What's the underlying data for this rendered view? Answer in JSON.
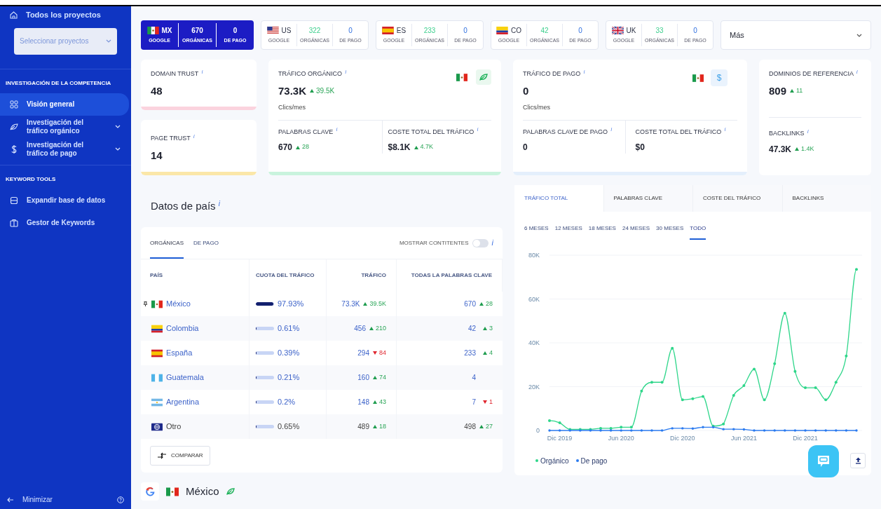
{
  "sidebar": {
    "top_link": "Todos los proyectos",
    "project_select": {
      "placeholder": "Seleccionar proyectos"
    },
    "sections": [
      {
        "heading": "INVESTIGACIÓN DE LA COMPETENCIA",
        "items": [
          {
            "label": "Visión general",
            "kind": "link",
            "selected": true
          },
          {
            "label": "Investigación del tráfico orgánico",
            "kind": "group",
            "selected": false
          },
          {
            "label": "Investigación del tráfico de pago",
            "kind": "group",
            "selected": false
          }
        ]
      },
      {
        "heading": "KEYWORD TOOLS",
        "items": [
          {
            "label": "Expandir base de datos",
            "kind": "link",
            "selected": false
          },
          {
            "label": "Gestor de Keywords",
            "kind": "link",
            "selected": false
          }
        ]
      }
    ],
    "minimize": "Minimizar"
  },
  "markets": [
    {
      "code": "MX",
      "engine": "GOOGLE",
      "organic": "670",
      "organic_label": "ORGÁNICAS",
      "paid": "0",
      "paid_label": "DE PAGO",
      "selected": true
    },
    {
      "code": "US",
      "engine": "GOOGLE",
      "organic": "322",
      "organic_label": "ORGÁNICAS",
      "paid": "0",
      "paid_label": "DE PAGO",
      "selected": false
    },
    {
      "code": "ES",
      "engine": "GOOGLE",
      "organic": "233",
      "organic_label": "ORGÁNICAS",
      "paid": "0",
      "paid_label": "DE PAGO",
      "selected": false
    },
    {
      "code": "CO",
      "engine": "GOOGLE",
      "organic": "42",
      "organic_label": "ORGÁNICAS",
      "paid": "0",
      "paid_label": "DE PAGO",
      "selected": false
    },
    {
      "code": "UK",
      "engine": "GOOGLE",
      "organic": "33",
      "organic_label": "ORGÁNICAS",
      "paid": "0",
      "paid_label": "DE PAGO",
      "selected": false
    }
  ],
  "more_select": {
    "value": "Más"
  },
  "metrics": {
    "domain_trust": {
      "label": "DOMAIN TRUST $^{i}$",
      "value": "48"
    },
    "page_trust": {
      "label": "PAGE TRUST $^{i}$",
      "value": "14"
    },
    "organic": {
      "label": "TRÁFICO ORGÁNICO $^{i}$",
      "value": "73.3K",
      "delta": {
        "text": "39.5K",
        "rising": true
      },
      "unit": "Clics/mes",
      "keywords": {
        "label": "PALABRAS CLAVE $^{i}$",
        "value": "670",
        "delta": {
          "text": "28",
          "rising": true
        }
      },
      "cost": {
        "label": "COSTE TOTAL DEL TRÁFICO $^{i}$",
        "value": "$8.1K",
        "delta": {
          "text": "4.7K",
          "rising": true
        }
      }
    },
    "paid": {
      "label": "TRÁFICO DE PAGO $^{i}$",
      "value": "0",
      "unit": "Clics/mes",
      "currency": "$",
      "keywords": {
        "label": "PALABRAS CLAVE DE PAGO $^{i}$",
        "value": "0"
      },
      "cost": {
        "label": "COSTE TOTAL DEL TRÁFICO $^{i}$",
        "value": "$0"
      }
    },
    "referring": {
      "domains": {
        "label": "DOMINIOS DE REFERENCIA $^{i}$",
        "value": "809",
        "delta": {
          "text": "11",
          "rising": true
        }
      },
      "backlinks": {
        "label": "BACKLINKS $^{i}$",
        "value": "47.3K",
        "delta": {
          "text": "1.4K",
          "rising": true
        }
      }
    }
  },
  "country_data": {
    "title": "Datos de país $^{i}$",
    "tabs": [
      {
        "label": "ORGÁNICAS",
        "selected": true
      },
      {
        "label": "DE PAGO",
        "selected": false
      }
    ],
    "continents_toggle": {
      "label": "MOSTRAR CONTITENTES",
      "on": false,
      "info": "i"
    },
    "columns": [
      "PAÍS",
      "CUOTA DEL TRÁFICO",
      "TRÁFICO",
      "TODAS LA PALABRAS CLAVE"
    ],
    "rows": [
      {
        "kind": "country",
        "pinned": true,
        "name": "México",
        "level": 0.9793,
        "share": "97.93%",
        "traffic": "73.3K",
        "traffic_delta": {
          "text": "39.5K",
          "rising": true
        },
        "keywords": "670",
        "keywords_delta": {
          "text": "28",
          "rising": true
        }
      },
      {
        "kind": "country",
        "pinned": false,
        "name": "Colombia",
        "level": 0.0061,
        "share": "0.61%",
        "traffic": "456",
        "traffic_delta": {
          "text": "210",
          "rising": true
        },
        "keywords": "42",
        "keywords_delta": {
          "text": "3",
          "rising": true
        }
      },
      {
        "kind": "country",
        "pinned": false,
        "name": "España",
        "level": 0.0039,
        "share": "0.39%",
        "traffic": "294",
        "traffic_delta": {
          "text": "84",
          "rising": false
        },
        "keywords": "233",
        "keywords_delta": {
          "text": "4",
          "rising": true
        }
      },
      {
        "kind": "country",
        "pinned": false,
        "name": "Guatemala",
        "level": 0.0021,
        "share": "0.21%",
        "traffic": "160",
        "traffic_delta": {
          "text": "74",
          "rising": true
        },
        "keywords": "4"
      },
      {
        "kind": "country",
        "pinned": false,
        "name": "Argentina",
        "level": 0.002,
        "share": "0.2%",
        "traffic": "148",
        "traffic_delta": {
          "text": "43",
          "rising": true
        },
        "keywords": "7",
        "keywords_delta": {
          "text": "1",
          "rising": false
        }
      },
      {
        "kind": "other",
        "pinned": false,
        "name": "Otro",
        "level": 0.0065,
        "share": "0.65%",
        "traffic": "489",
        "traffic_delta": {
          "text": "18",
          "rising": true
        },
        "keywords": "498",
        "keywords_delta": {
          "text": "27",
          "rising": true
        }
      }
    ],
    "compare_button": "COMPARAR"
  },
  "traffic_chart": {
    "tabs": [
      {
        "label": "TRÁFICO TOTAL",
        "selected": true
      },
      {
        "label": "PALABRAS CLAVE",
        "selected": false
      },
      {
        "label": "COSTE DEL TRÁFICO",
        "selected": false
      },
      {
        "label": "BACKLINKS",
        "selected": false
      }
    ],
    "periods": [
      {
        "label": "6 MESES",
        "selected": false
      },
      {
        "label": "12 MESES",
        "selected": false
      },
      {
        "label": "18 MESES",
        "selected": false
      },
      {
        "label": "24 MESES",
        "selected": false
      },
      {
        "label": "30 MESES",
        "selected": false
      },
      {
        "label": "TODO",
        "selected": true
      }
    ],
    "chart_data": {
      "type": "line",
      "categories": [
        null,
        "Dic 2019",
        null,
        null,
        null,
        null,
        null,
        "Jun 2020",
        null,
        null,
        null,
        null,
        null,
        "Dic 2020",
        null,
        null,
        null,
        null,
        null,
        "Jun 2021",
        null,
        null,
        null,
        null,
        null,
        "Dic 2021",
        null,
        null,
        null,
        null,
        null
      ],
      "series": [
        {
          "name": "Orgánico",
          "color": "#2ed68a",
          "values": [
            4500,
            3500,
            500,
            500,
            500,
            1000,
            1000,
            1500,
            1500,
            18000,
            22000,
            22000,
            37500,
            14000,
            14500,
            15500,
            2000,
            3000,
            16000,
            20500,
            28000,
            14000,
            30500,
            53500,
            27000,
            19500,
            19500,
            14000,
            22000,
            34000,
            73500
          ]
        },
        {
          "name": "De pago",
          "color": "#2b7bf0",
          "values": [
            0,
            0,
            0,
            0,
            0,
            0,
            0,
            0,
            0,
            0,
            0,
            0,
            1000,
            1000,
            900,
            1500,
            1500,
            600,
            600,
            500,
            0,
            0,
            0,
            0,
            0,
            0,
            0,
            0,
            0,
            0,
            0
          ]
        }
      ],
      "ylim": [
        0,
        80000
      ],
      "grid": true,
      "yticks": [
        {
          "value": 0,
          "label": "0"
        },
        {
          "value": 20000,
          "label": "20K"
        },
        {
          "value": 40000,
          "label": "40K"
        },
        {
          "value": 60000,
          "label": "60K"
        },
        {
          "value": 80000,
          "label": "80K"
        }
      ]
    }
  },
  "location": {
    "country": "México"
  }
}
